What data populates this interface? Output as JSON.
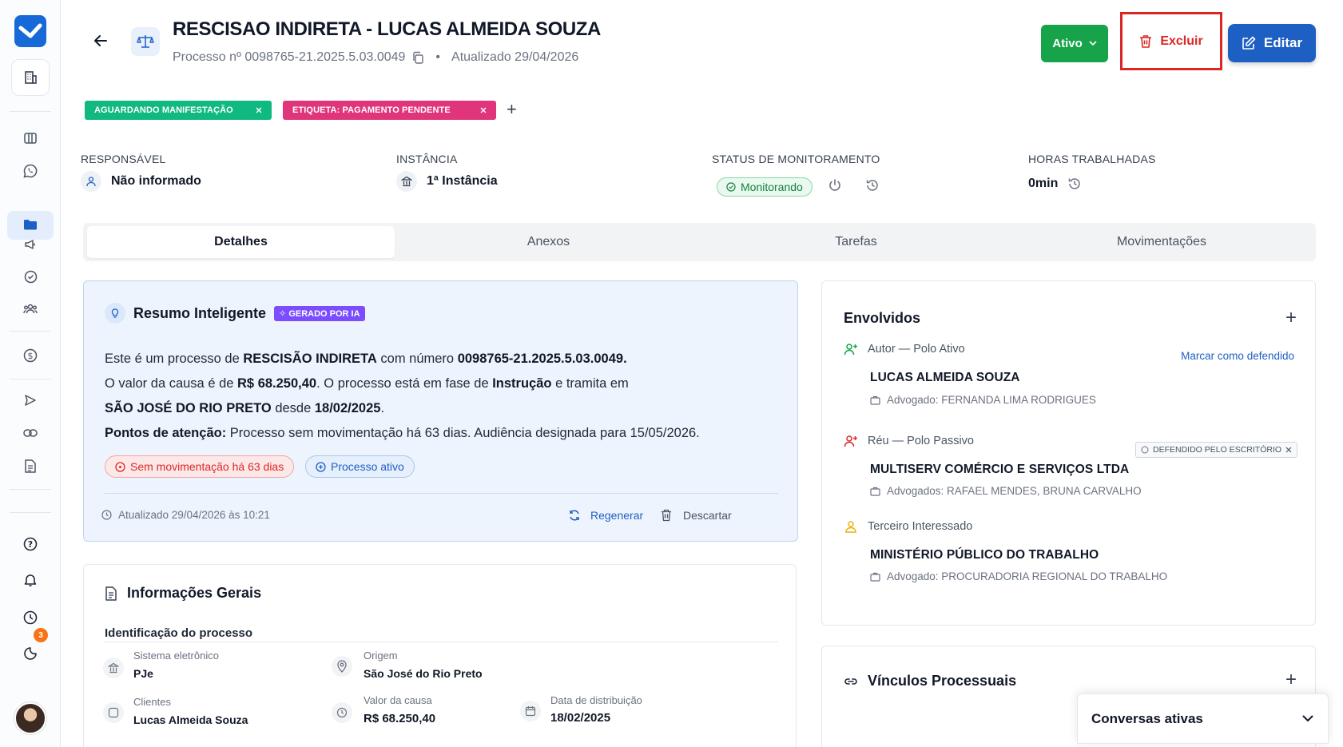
{
  "sidebar": {
    "notification_count": "3",
    "items": [
      "logo-icon",
      "building-icon",
      "columns-icon",
      "whatsapp-icon",
      "folder-icon",
      "megaphone-icon",
      "check-circle-icon",
      "users-icon",
      "dollar-icon",
      "send-icon",
      "link-icon",
      "document-icon",
      "help-icon",
      "bell-icon",
      "clock-icon",
      "theme-icon"
    ]
  },
  "header": {
    "title": "RESCISAO INDIRETA - LUCAS ALMEIDA SOUZA",
    "process_number": "Processo nº 0098765-21.2025.5.03.0049",
    "updated": "Atualizado 29/04/2026",
    "status_button": "Ativo",
    "delete_button": "Excluir",
    "edit_button": "Editar"
  },
  "tags": [
    {
      "label": "AGUARDANDO MANIFESTAÇÃO",
      "color": "#10b981"
    },
    {
      "label": "ETIQUETA: PAGAMENTO PENDENTE",
      "color": "#e0357a"
    }
  ],
  "tag_add": "+",
  "meta": {
    "responsavel_label": "RESPONSÁVEL",
    "responsavel_value": "Não informado",
    "instancia_label": "INSTÂNCIA",
    "instancia_value": "1ª Instância",
    "status_label": "STATUS DE MONITORAMENTO",
    "status_value": "Monitorando",
    "horas_label": "HORAS TRABALHADAS",
    "horas_value": "0min"
  },
  "tabs": [
    "Detalhes",
    "Anexos",
    "Tarefas",
    "Movimentações"
  ],
  "ai_summary": {
    "title": "Resumo Inteligente",
    "badge": "GERADO POR IA",
    "p1a": "Este é um processo de ",
    "p1b": "RESCISÃO INDIRETA",
    "p1c": " com número ",
    "p1d": "0098765-21.2025.5.03.0049",
    "p1e": ".",
    "p2a": "O valor da causa é de ",
    "p2b": "R$ 68.250,40",
    "p2c": ". O processo está em fase de ",
    "p2d": "Instrução",
    "p2e": " e tramita em",
    "p3a": "SÃO JOSÉ DO RIO PRETO",
    "p3b": " desde ",
    "p3c": "18/02/2025",
    "p3d": ".",
    "p4a": "Pontos de atenção:",
    "p4b": " Processo sem movimentação há 63 dias. Audiência designada para 15/05/2026.",
    "pill_red": "Sem movimentação há 63 dias",
    "pill_blue": "Processo ativo",
    "updated": "Atualizado 29/04/2026 às 10:21",
    "regenerate": "Regenerar",
    "discard": "Descartar"
  },
  "info": {
    "title": "Informações Gerais",
    "subtitle": "Identificação do processo",
    "fields": [
      {
        "label": "Sistema eletrônico",
        "value": "PJe"
      },
      {
        "label": "Origem",
        "value": "São José do Rio Preto"
      },
      {
        "label": "Clientes",
        "value": "Lucas Almeida Souza"
      },
      {
        "label": "Valor da causa",
        "value": "R$ 68.250,40"
      },
      {
        "label": "Data de distribuição",
        "value": "18/02/2025"
      }
    ]
  },
  "involved": {
    "title": "Envolvidos",
    "mark_link": "Marcar como defendido",
    "defended_badge": "DEFENDIDO PELO ESCRITÓRIO",
    "parties": [
      {
        "role": "Autor — Polo Ativo",
        "name": "LUCAS ALMEIDA SOUZA",
        "lawyer": "Advogado: FERNANDA LIMA RODRIGUES",
        "color": "#16a34a"
      },
      {
        "role": "Réu — Polo Passivo",
        "name": "MULTISERV COMÉRCIO E SERVIÇOS LTDA",
        "lawyer": "Advogados: RAFAEL MENDES, BRUNA CARVALHO",
        "color": "#dc2626"
      },
      {
        "role": "Terceiro Interessado",
        "name": "MINISTÉRIO PÚBLICO DO TRABALHO",
        "lawyer": "Advogado: PROCURADORIA REGIONAL DO TRABALHO",
        "color": "#eab308"
      }
    ]
  },
  "links": {
    "title": "Vínculos Processuais"
  },
  "chat": {
    "title": "Conversas ativas"
  }
}
